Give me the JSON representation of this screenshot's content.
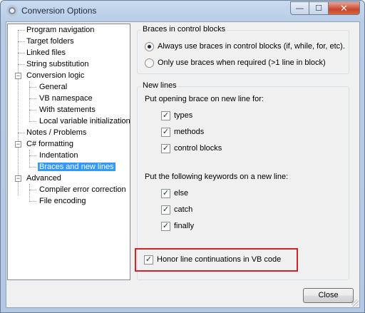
{
  "window": {
    "title": "Conversion Options",
    "icon": "gear-icon",
    "minimize_glyph": "—",
    "maximize_glyph": "☐",
    "close_glyph": "✕"
  },
  "tree": {
    "items": [
      {
        "label": "Program navigation"
      },
      {
        "label": "Target folders"
      },
      {
        "label": "Linked files"
      },
      {
        "label": "String substitution"
      },
      {
        "label": "Conversion logic",
        "expanded": true
      },
      {
        "label": "General"
      },
      {
        "label": "VB namespace"
      },
      {
        "label": "With statements"
      },
      {
        "label": "Local variable initialization"
      },
      {
        "label": "Notes / Problems"
      },
      {
        "label": "C# formatting",
        "expanded": true
      },
      {
        "label": "Indentation"
      },
      {
        "label": "Braces and new lines",
        "selected": true
      },
      {
        "label": "Advanced",
        "expanded": true
      },
      {
        "label": "Compiler error correction"
      },
      {
        "label": "File encoding"
      }
    ],
    "expanded_glyph": "−"
  },
  "braces_group": {
    "title": "Braces in control blocks",
    "options": [
      {
        "label": "Always use braces in control blocks (if, while, for, etc).",
        "selected": true
      },
      {
        "label": "Only use braces when required (>1 line in block)",
        "selected": false
      }
    ]
  },
  "newlines_group": {
    "title": "New lines",
    "opening_brace_label": "Put opening brace on new line for:",
    "opening_brace_options": [
      {
        "label": "types",
        "checked": true
      },
      {
        "label": "methods",
        "checked": true
      },
      {
        "label": "control blocks",
        "checked": true
      }
    ],
    "keywords_label": "Put the following keywords on a new line:",
    "keyword_options": [
      {
        "label": "else",
        "checked": true
      },
      {
        "label": "catch",
        "checked": true
      },
      {
        "label": "finally",
        "checked": true
      }
    ],
    "honor_line_continuations": {
      "label": "Honor line continuations in VB code",
      "checked": true
    }
  },
  "check_glyph": "✓",
  "footer": {
    "close_label": "Close"
  },
  "colors": {
    "selection": "#3399ff",
    "highlight_box": "#d0232a"
  }
}
